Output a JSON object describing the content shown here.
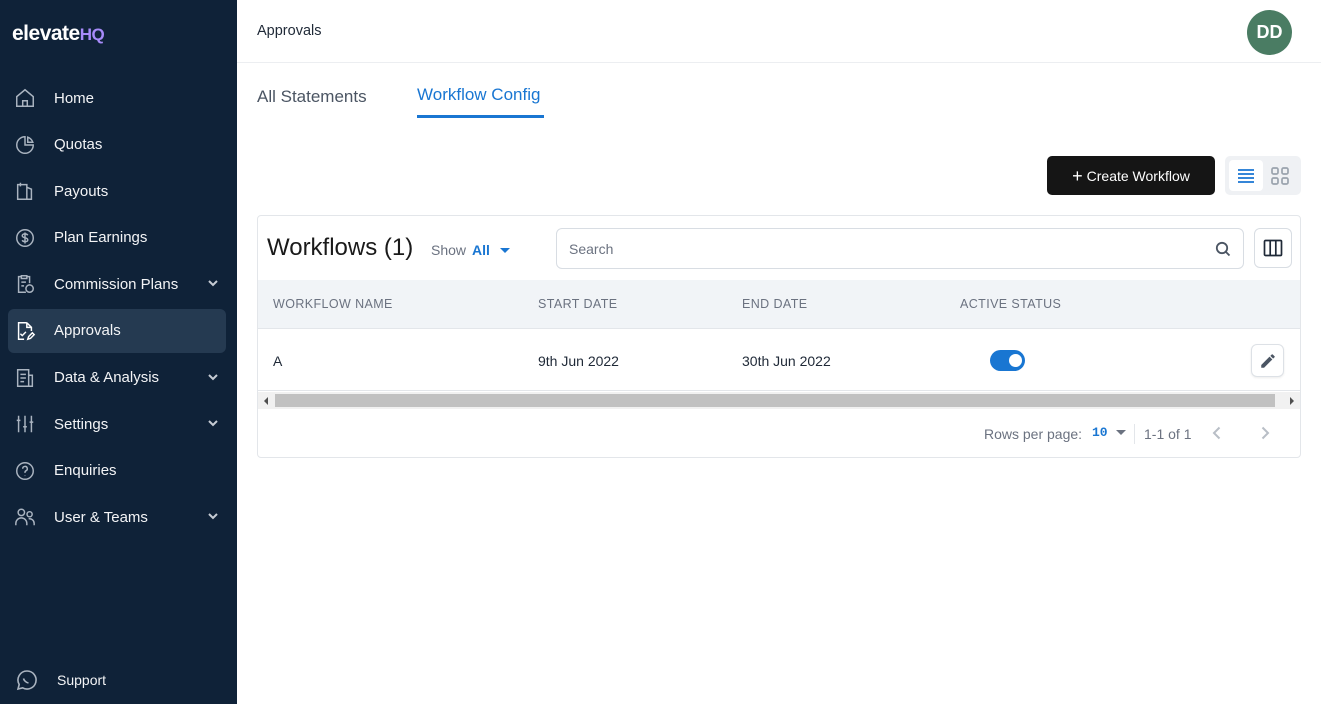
{
  "app": {
    "logo_main": "elevate",
    "logo_suffix": "HQ"
  },
  "sidebar": {
    "items": [
      {
        "label": "Home",
        "icon": "home-icon",
        "has_submenu": false,
        "active": false
      },
      {
        "label": "Quotas",
        "icon": "pie-chart-icon",
        "has_submenu": false,
        "active": false
      },
      {
        "label": "Payouts",
        "icon": "payouts-icon",
        "has_submenu": false,
        "active": false
      },
      {
        "label": "Plan Earnings",
        "icon": "dollar-circle-icon",
        "has_submenu": false,
        "active": false
      },
      {
        "label": "Commission Plans",
        "icon": "clipboard-icon",
        "has_submenu": true,
        "active": false
      },
      {
        "label": "Approvals",
        "icon": "approval-document-icon",
        "has_submenu": false,
        "active": true
      },
      {
        "label": "Data & Analysis",
        "icon": "report-icon",
        "has_submenu": true,
        "active": false
      },
      {
        "label": "Settings",
        "icon": "sliders-icon",
        "has_submenu": true,
        "active": false
      },
      {
        "label": "Enquiries",
        "icon": "help-circle-icon",
        "has_submenu": false,
        "active": false
      },
      {
        "label": "User & Teams",
        "icon": "users-icon",
        "has_submenu": true,
        "active": false
      }
    ],
    "support_label": "Support"
  },
  "header": {
    "breadcrumb": "Approvals",
    "avatar_initials": "DD",
    "avatar_color": "#4a7c63"
  },
  "tabs": [
    {
      "label": "All Statements",
      "active": false
    },
    {
      "label": "Workflow Config",
      "active": true
    }
  ],
  "toolbar": {
    "create_label": "Create Workflow",
    "view_mode": "list"
  },
  "table": {
    "title": "Workflows (1)",
    "show_label": "Show",
    "show_value": "All",
    "search_placeholder": "Search",
    "search_value": "",
    "columns": [
      "WORKFLOW NAME",
      "START DATE",
      "END DATE",
      "ACTIVE STATUS"
    ],
    "rows": [
      {
        "name": "A",
        "start_date": "9th Jun 2022",
        "end_date": "30th Jun 2022",
        "active": true
      }
    ]
  },
  "pagination": {
    "rows_per_page_label": "Rows per page:",
    "rows_per_page": "10",
    "range": "1-1 of 1"
  },
  "colors": {
    "sidebar_bg": "#0f2238",
    "accent": "#1976d2",
    "primary_button": "#151515"
  }
}
